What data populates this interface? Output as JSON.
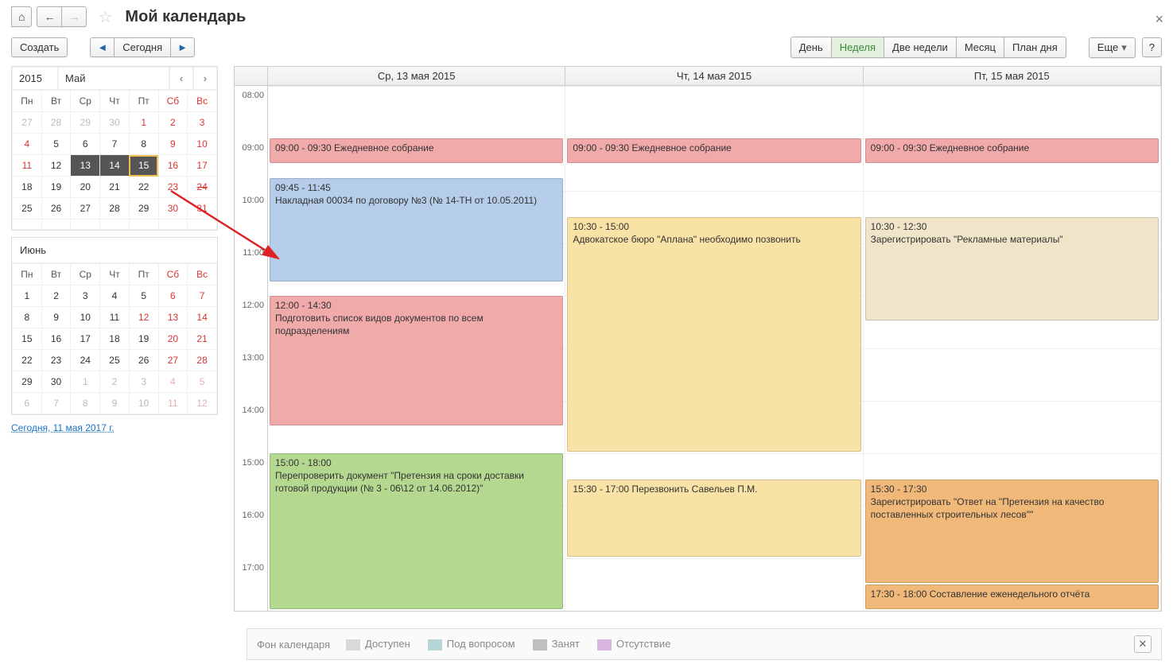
{
  "header": {
    "title": "Мой календарь"
  },
  "toolbar": {
    "create": "Создать",
    "today": "Сегодня",
    "more": "Еще"
  },
  "views": {
    "day": "День",
    "week": "Неделя",
    "twoweeks": "Две недели",
    "month": "Месяц",
    "dayplan": "План дня"
  },
  "mini1": {
    "year": "2015",
    "month": "Май",
    "dow": [
      "Пн",
      "Вт",
      "Ср",
      "Чт",
      "Пт",
      "Сб",
      "Вс"
    ],
    "rows": [
      [
        {
          "d": "27",
          "dim": 1
        },
        {
          "d": "28",
          "dim": 1
        },
        {
          "d": "29",
          "dim": 1
        },
        {
          "d": "30",
          "dim": 1
        },
        {
          "d": "1",
          "wknd": 1
        },
        {
          "d": "2",
          "wknd": 1
        },
        {
          "d": "3",
          "wknd": 1
        }
      ],
      [
        {
          "d": "4",
          "wknd": 1
        },
        {
          "d": "5"
        },
        {
          "d": "6"
        },
        {
          "d": "7"
        },
        {
          "d": "8"
        },
        {
          "d": "9",
          "wknd": 1
        },
        {
          "d": "10",
          "wknd": 1
        }
      ],
      [
        {
          "d": "11",
          "wknd": 1
        },
        {
          "d": "12"
        },
        {
          "d": "13",
          "sel": 1
        },
        {
          "d": "14",
          "sel": 1
        },
        {
          "d": "15",
          "sel": 1,
          "wrap": 1
        },
        {
          "d": "16",
          "wknd": 1
        },
        {
          "d": "17",
          "wknd": 1
        }
      ],
      [
        {
          "d": "18"
        },
        {
          "d": "19"
        },
        {
          "d": "20"
        },
        {
          "d": "21"
        },
        {
          "d": "22"
        },
        {
          "d": "23",
          "wknd": 1
        },
        {
          "d": "24",
          "wknd": 1,
          "strike": 1
        }
      ],
      [
        {
          "d": "25"
        },
        {
          "d": "26"
        },
        {
          "d": "27"
        },
        {
          "d": "28"
        },
        {
          "d": "29"
        },
        {
          "d": "30",
          "wknd": 1
        },
        {
          "d": "31",
          "wknd": 1
        }
      ],
      [
        {
          "d": ""
        },
        {
          "d": ""
        },
        {
          "d": ""
        },
        {
          "d": ""
        },
        {
          "d": ""
        },
        {
          "d": ""
        },
        {
          "d": ""
        }
      ]
    ]
  },
  "mini2": {
    "month": "Июнь",
    "dow": [
      "Пн",
      "Вт",
      "Ср",
      "Чт",
      "Пт",
      "Сб",
      "Вс"
    ],
    "rows": [
      [
        {
          "d": "1"
        },
        {
          "d": "2"
        },
        {
          "d": "3"
        },
        {
          "d": "4"
        },
        {
          "d": "5"
        },
        {
          "d": "6",
          "wknd": 1
        },
        {
          "d": "7",
          "wknd": 1
        }
      ],
      [
        {
          "d": "8"
        },
        {
          "d": "9"
        },
        {
          "d": "10"
        },
        {
          "d": "11"
        },
        {
          "d": "12",
          "wknd": 1
        },
        {
          "d": "13",
          "wknd": 1
        },
        {
          "d": "14",
          "wknd": 1
        }
      ],
      [
        {
          "d": "15"
        },
        {
          "d": "16"
        },
        {
          "d": "17"
        },
        {
          "d": "18"
        },
        {
          "d": "19"
        },
        {
          "d": "20",
          "wknd": 1
        },
        {
          "d": "21",
          "wknd": 1
        }
      ],
      [
        {
          "d": "22"
        },
        {
          "d": "23"
        },
        {
          "d": "24"
        },
        {
          "d": "25"
        },
        {
          "d": "26"
        },
        {
          "d": "27",
          "wknd": 1
        },
        {
          "d": "28",
          "wknd": 1
        }
      ],
      [
        {
          "d": "29"
        },
        {
          "d": "30"
        },
        {
          "d": "1",
          "dim": 1
        },
        {
          "d": "2",
          "dim": 1
        },
        {
          "d": "3",
          "dim": 1
        },
        {
          "d": "4",
          "dim": 1
        },
        {
          "d": "5",
          "dim": 1
        }
      ],
      [
        {
          "d": "6",
          "dim": 1
        },
        {
          "d": "7",
          "dim": 1
        },
        {
          "d": "8",
          "dim": 1
        },
        {
          "d": "9",
          "dim": 1
        },
        {
          "d": "10",
          "dim": 1
        },
        {
          "d": "11",
          "dim": 1
        },
        {
          "d": "12",
          "dim": 1
        }
      ]
    ]
  },
  "todaylink": "Сегодня, 11 мая 2017 г.",
  "days": [
    "Ср, 13 мая 2015",
    "Чт, 14 мая 2015",
    "Пт, 15 мая 2015"
  ],
  "hours": [
    "08:00",
    "09:00",
    "10:00",
    "11:00",
    "12:00",
    "13:00",
    "14:00",
    "15:00",
    "16:00",
    "17:00"
  ],
  "hourPx": 66,
  "startHour": 8,
  "events": [
    {
      "day": 0,
      "start": 9,
      "end": 9.5,
      "cls": "ev-pink",
      "text": "09:00 - 09:30 Ежедневное собрание"
    },
    {
      "day": 0,
      "start": 9.75,
      "end": 11.75,
      "cls": "ev-blue",
      "text": "09:45 - 11:45\nНакладная 00034 по договору №3 (№ 14-ТН от 10.05.2011)"
    },
    {
      "day": 0,
      "start": 12,
      "end": 14.5,
      "cls": "ev-pink",
      "text": "12:00 - 14:30\nПодготовить список видов документов по всем подразделениям"
    },
    {
      "day": 0,
      "start": 15,
      "end": 18,
      "cls": "ev-green",
      "text": "15:00 - 18:00\nПерепроверить документ \"Претензия на сроки доставки готовой продукции (№ 3 - 06\\12 от 14.06.2012)\""
    },
    {
      "day": 1,
      "start": 9,
      "end": 9.5,
      "cls": "ev-pink",
      "text": "09:00 - 09:30 Ежедневное собрание"
    },
    {
      "day": 1,
      "start": 10.5,
      "end": 15,
      "cls": "ev-yellow",
      "text": "10:30 - 15:00\nАдвокатское бюро \"Аплана\" необходимо позвонить"
    },
    {
      "day": 1,
      "start": 15.5,
      "end": 17,
      "cls": "ev-yellow",
      "text": "15:30 - 17:00 Перезвонить Савельев П.М."
    },
    {
      "day": 2,
      "start": 9,
      "end": 9.5,
      "cls": "ev-pink",
      "text": "09:00 - 09:30 Ежедневное собрание"
    },
    {
      "day": 2,
      "start": 10.5,
      "end": 12.5,
      "cls": "ev-beige",
      "text": "10:30 - 12:30\nЗарегистрировать \"Рекламные материалы\""
    },
    {
      "day": 2,
      "start": 15.5,
      "end": 17.5,
      "cls": "ev-orange",
      "text": "15:30 - 17:30\nЗарегистрировать \"Ответ на \"Претензия на качество поставленных строительных лесов\"\""
    },
    {
      "day": 2,
      "start": 17.5,
      "end": 18,
      "cls": "ev-orange",
      "text": "17:30 - 18:00 Составление еженедельного отчёта"
    }
  ],
  "legend": {
    "title": "Фон календаря",
    "items": [
      {
        "color": "#d9d9d9",
        "label": "Доступен"
      },
      {
        "color": "#b6d6d6",
        "label": "Под вопросом"
      },
      {
        "color": "#bfbfbf",
        "label": "Занят"
      },
      {
        "color": "#d9b6e0",
        "label": "Отсутствие"
      }
    ]
  }
}
